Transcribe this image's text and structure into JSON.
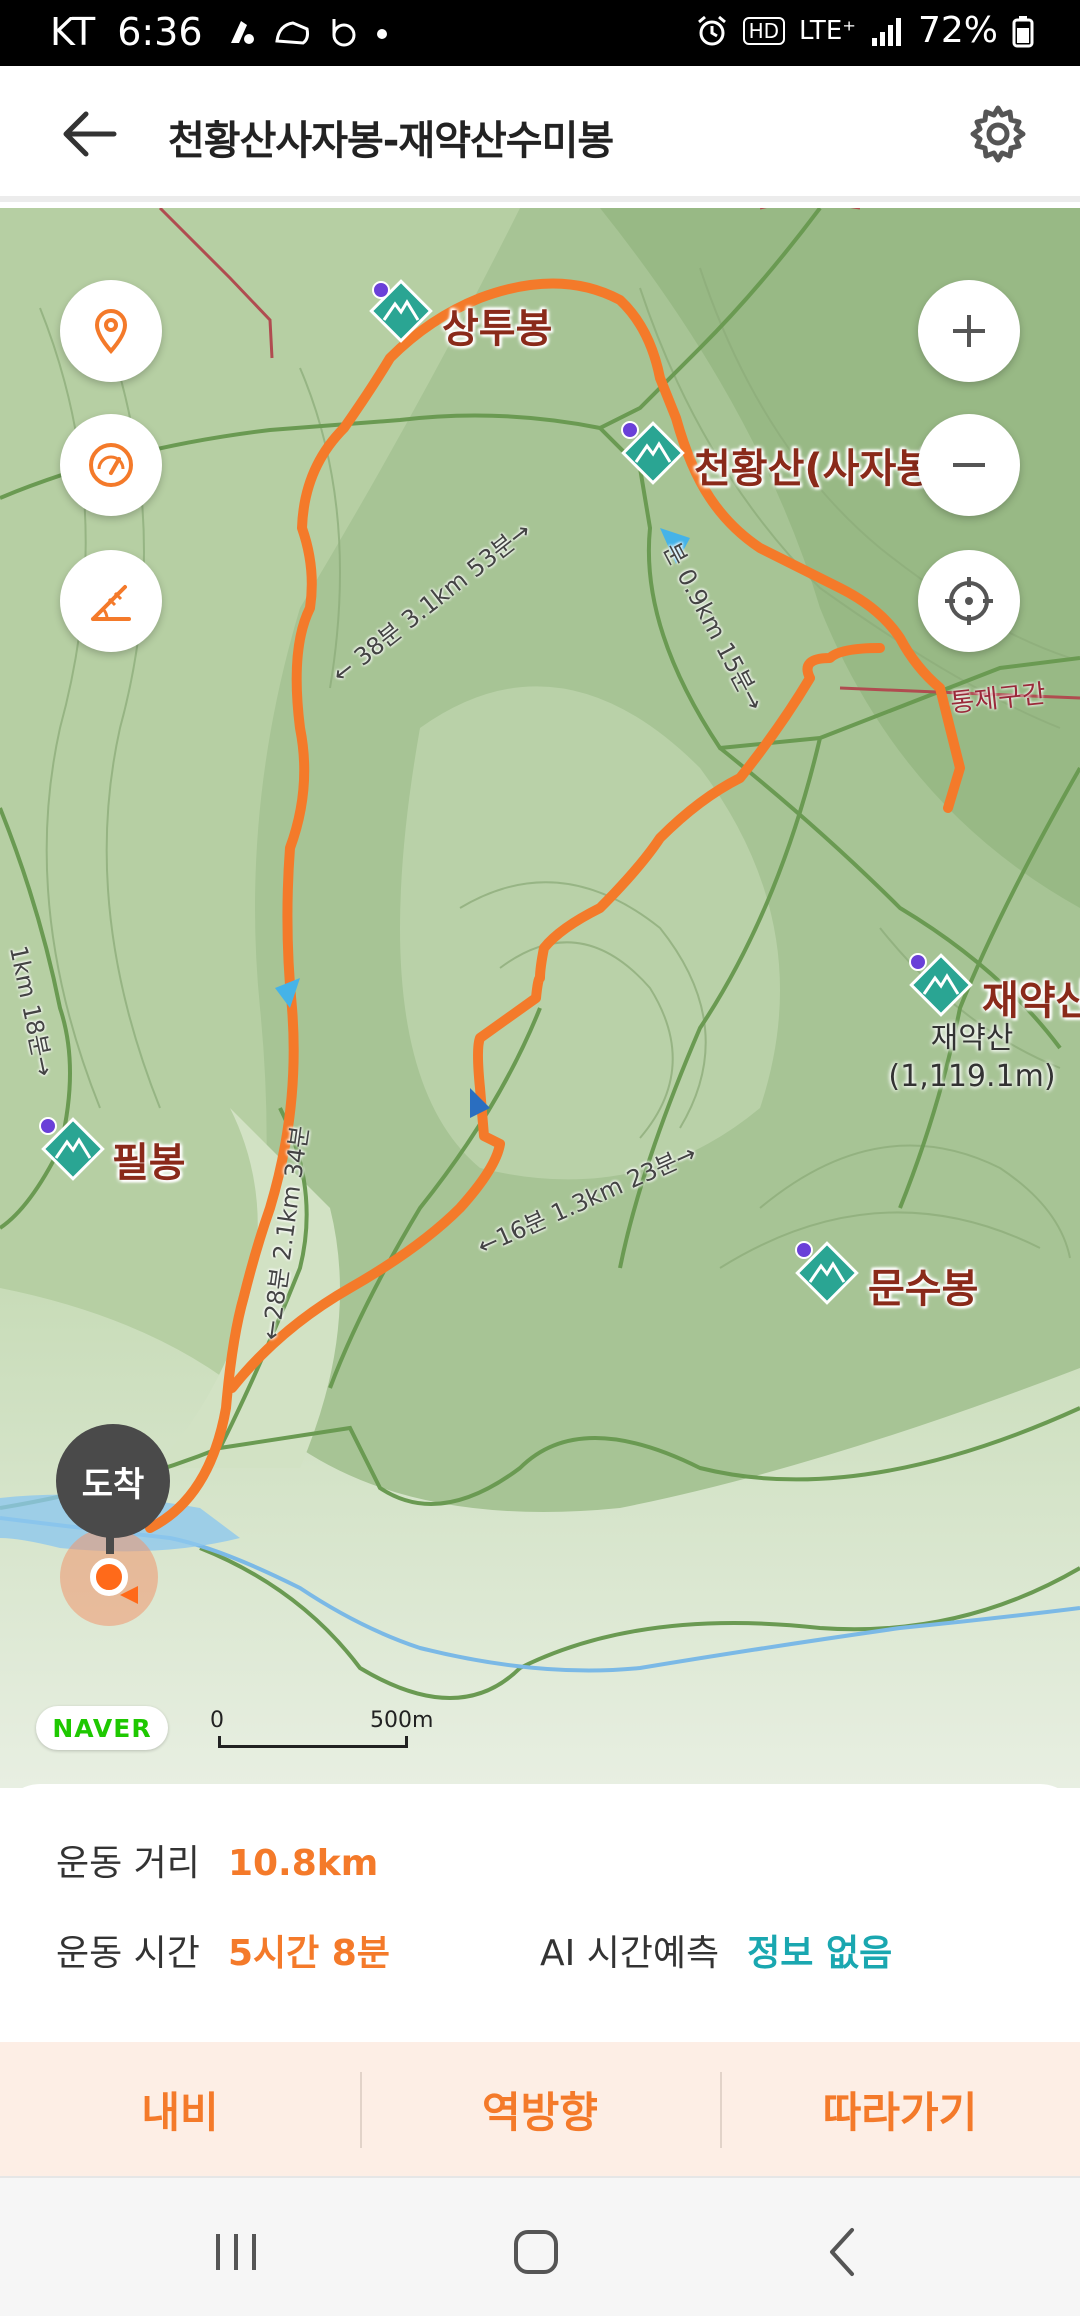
{
  "status_bar": {
    "carrier": "KT",
    "time": "6:36",
    "network": "LTE⁺",
    "hd": "HD",
    "battery": "72%"
  },
  "header": {
    "title": "천황산사자봉-재약산수미봉",
    "back_icon": "arrow-left-icon",
    "settings_icon": "gear-icon"
  },
  "map": {
    "peaks": {
      "sangtubong": "상투봉",
      "cheonhwangsan": "천황산(사자봉",
      "jaeyaksan": "재약산",
      "jaeyaksan_sub_name": "재약산",
      "jaeyaksan_sub_elev": "(1,119.1m)",
      "munsubong": "문수봉",
      "pilbong": "필봉"
    },
    "zone_label": "통제구간",
    "trail_labels": {
      "t1": "← 38분 3.1km 53분→",
      "t2": "분 0.9km 15분→",
      "t3": "←16분 1.3km 23분→",
      "t4": "←28분 2.1km 34분",
      "t5": "1km 18분→"
    },
    "arrival_label": "도착",
    "attribution": "NAVER",
    "scale_zero": "0",
    "scale_label": "500m",
    "route_color": "#f47a2a",
    "controls": [
      "location-pin-icon",
      "speed-gauge-icon",
      "slope-icon",
      "zoom-in-icon",
      "zoom-out-icon",
      "crosshair-icon"
    ]
  },
  "info": {
    "distance_label": "운동 거리",
    "distance_value": "10.8km",
    "time_label": "운동 시간",
    "time_value": "5시간 8분",
    "ai_label": "AI 시간예측",
    "ai_value": "정보 없음"
  },
  "actions": {
    "navi": "내비",
    "reverse": "역방향",
    "follow": "따라가기"
  },
  "nav_bar": [
    "recent-apps-icon",
    "home-icon",
    "back-icon"
  ]
}
